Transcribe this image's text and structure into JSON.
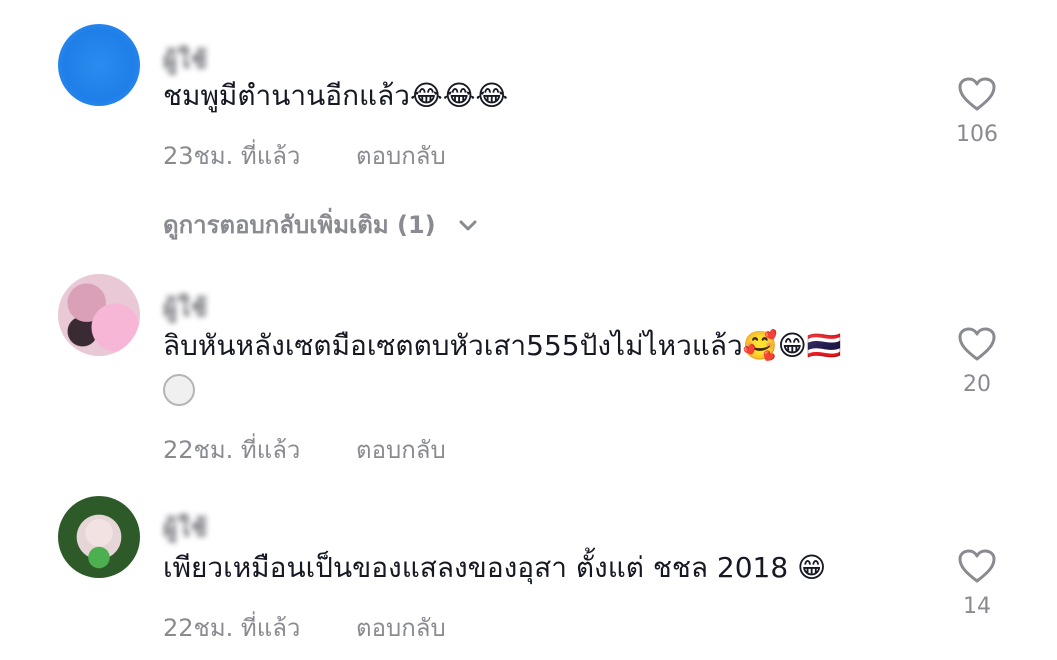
{
  "comments": [
    {
      "username": "ผู้ใช้",
      "text": "ชมพูมีตำนานอีกแล้ว😂😂😂",
      "time": "23ชม. ที่แล้ว",
      "reply_label": "ตอบกลับ",
      "likes": "106",
      "avatar_color": "#1f7fe8"
    },
    {
      "username": "ผู้ใช้",
      "text": "ลิบหันหลังเซตมือเซตตบหัวเสา555ปังไม่ไหวแล้ว🥰😁🇹🇭",
      "text_line2_icon": "volleyball-icon",
      "time": "22ชม. ที่แล้ว",
      "reply_label": "ตอบกลับ",
      "likes": "20"
    },
    {
      "username": "ผู้ใช้",
      "text": "เพียวเหมือนเป็นของแสลงของอุสา ตั้งแต่ ชชล 2018 😁",
      "time": "22ชม. ที่แล้ว",
      "reply_label": "ตอบกลับ",
      "likes": "14"
    }
  ],
  "view_more_replies": "ดูการตอบกลับเพิ่มเติม (1)",
  "colors": {
    "text": "#161823",
    "muted": "#8a8b91"
  }
}
